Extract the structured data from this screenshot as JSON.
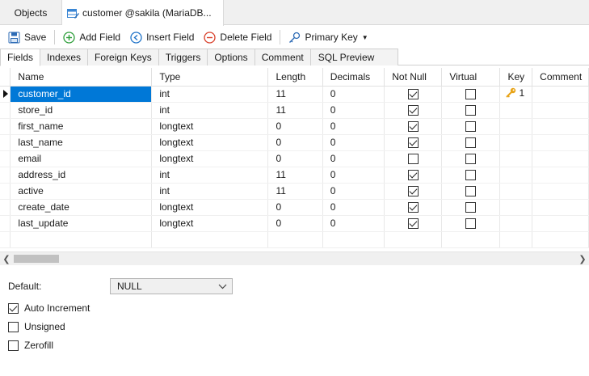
{
  "doc_tabs": {
    "objects_label": "Objects",
    "active_label": "customer @sakila (MariaDB..."
  },
  "toolbar": {
    "save_label": "Save",
    "add_field_label": "Add Field",
    "insert_field_label": "Insert Field",
    "delete_field_label": "Delete Field",
    "primary_key_label": "Primary Key"
  },
  "section_tabs": [
    "Fields",
    "Indexes",
    "Foreign Keys",
    "Triggers",
    "Options",
    "Comment",
    "SQL Preview"
  ],
  "grid": {
    "columns": [
      "Name",
      "Type",
      "Length",
      "Decimals",
      "Not Null",
      "Virtual",
      "Key",
      "Comment"
    ],
    "rows": [
      {
        "name": "customer_id",
        "type": "int",
        "length": "11",
        "decimals": "0",
        "not_null": true,
        "virtual": false,
        "key": "1"
      },
      {
        "name": "store_id",
        "type": "int",
        "length": "11",
        "decimals": "0",
        "not_null": true,
        "virtual": false,
        "key": ""
      },
      {
        "name": "first_name",
        "type": "longtext",
        "length": "0",
        "decimals": "0",
        "not_null": true,
        "virtual": false,
        "key": ""
      },
      {
        "name": "last_name",
        "type": "longtext",
        "length": "0",
        "decimals": "0",
        "not_null": true,
        "virtual": false,
        "key": ""
      },
      {
        "name": "email",
        "type": "longtext",
        "length": "0",
        "decimals": "0",
        "not_null": false,
        "virtual": false,
        "key": ""
      },
      {
        "name": "address_id",
        "type": "int",
        "length": "11",
        "decimals": "0",
        "not_null": true,
        "virtual": false,
        "key": ""
      },
      {
        "name": "active",
        "type": "int",
        "length": "11",
        "decimals": "0",
        "not_null": true,
        "virtual": false,
        "key": ""
      },
      {
        "name": "create_date",
        "type": "longtext",
        "length": "0",
        "decimals": "0",
        "not_null": true,
        "virtual": false,
        "key": ""
      },
      {
        "name": "last_update",
        "type": "longtext",
        "length": "0",
        "decimals": "0",
        "not_null": true,
        "virtual": false,
        "key": ""
      }
    ]
  },
  "props": {
    "default_label": "Default:",
    "default_value": "NULL",
    "auto_increment_label": "Auto Increment",
    "auto_increment_checked": true,
    "unsigned_label": "Unsigned",
    "unsigned_checked": false,
    "zerofill_label": "Zerofill",
    "zerofill_checked": false
  },
  "colors": {
    "selection": "#0078d7",
    "key_icon": "#e8a317",
    "add_icon": "#2e9e3a",
    "insert_icon": "#1f73c8",
    "delete_icon": "#d9412c"
  }
}
